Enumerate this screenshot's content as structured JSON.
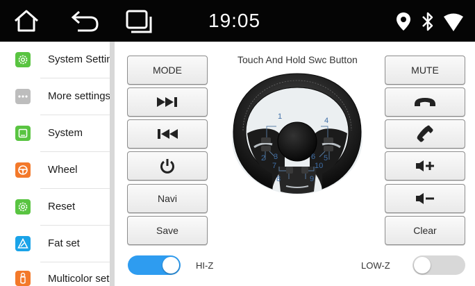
{
  "status_bar": {
    "time": "19:05",
    "icons": [
      "home-icon",
      "back-icon",
      "recent-apps-icon",
      "location-icon",
      "bluetooth-icon",
      "wifi-icon"
    ]
  },
  "sidebar": {
    "items": [
      {
        "label": "System Settings",
        "icon": "settings-icon",
        "color": "#59c441"
      },
      {
        "label": "More settings",
        "icon": "more-icon",
        "color": "#bdbdbd"
      },
      {
        "label": "System",
        "icon": "system-icon",
        "color": "#59c441"
      },
      {
        "label": "Wheel",
        "icon": "steering-wheel-icon",
        "color": "#f3792a"
      },
      {
        "label": "Reset",
        "icon": "reset-icon",
        "color": "#59c441"
      },
      {
        "label": "Fat set",
        "icon": "fat-set-icon",
        "color": "#1aa3e8"
      },
      {
        "label": "Multicolor set",
        "icon": "multicolor-icon",
        "color": "#f3792a"
      }
    ]
  },
  "main": {
    "title": "Touch And Hold Swc Button",
    "left_buttons": [
      {
        "label": "MODE",
        "icon": null
      },
      {
        "label": "",
        "icon": "next-track-icon"
      },
      {
        "label": "",
        "icon": "previous-track-icon"
      },
      {
        "label": "",
        "icon": "power-icon"
      },
      {
        "label": "Navi",
        "icon": null
      },
      {
        "label": "Save",
        "icon": null
      }
    ],
    "right_buttons": [
      {
        "label": "MUTE",
        "icon": null
      },
      {
        "label": "",
        "icon": "hang-up-icon"
      },
      {
        "label": "",
        "icon": "call-icon"
      },
      {
        "label": "",
        "icon": "volume-up-icon"
      },
      {
        "label": "",
        "icon": "volume-down-icon"
      },
      {
        "label": "Clear",
        "icon": null
      }
    ],
    "wheel_labels": [
      "1",
      "2",
      "3",
      "4",
      "5",
      "6",
      "7",
      "8",
      "9",
      "10"
    ],
    "hi_z": {
      "label": "HI-Z",
      "on": true,
      "color": "#2e9cf0"
    },
    "low_z": {
      "label": "LOW-Z",
      "on": false,
      "color": "#d8d8d8"
    }
  }
}
